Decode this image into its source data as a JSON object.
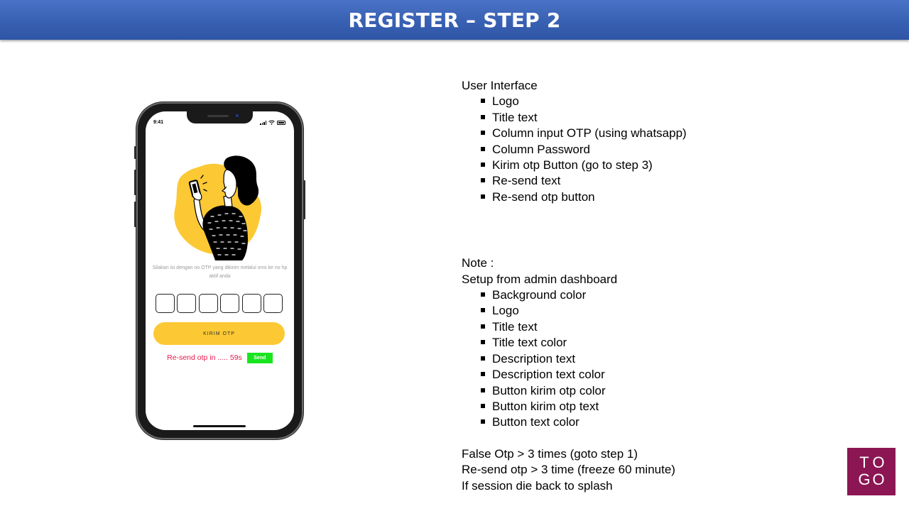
{
  "header": {
    "title": "REGISTER – STEP 2"
  },
  "phone": {
    "status_time": "9:41",
    "description": "Silakan isi dengan no OTP yang dikirim melalui sms ke no hp aktif anda",
    "otp_box_count": 6,
    "kirim_button_label": "KIRIM OTP",
    "resend_text": "Re-send otp in ..... 59s",
    "send_button_label": "Send",
    "colors": {
      "kirim_button": "#fcc934",
      "resend_text": "#e8194a",
      "send_button": "#19e51f",
      "illustration_blob": "#fcc934"
    }
  },
  "panel": {
    "ui_heading": "User Interface",
    "ui_items": [
      "Logo",
      "Title text",
      "Column input OTP (using whatsapp)",
      "Column Password",
      "Kirim otp Button (go to step 3)",
      "Re-send text",
      "Re-send otp button"
    ],
    "note_heading": "Note :",
    "note_subheading": "Setup from admin dashboard",
    "note_items": [
      "Background color",
      "Logo",
      "Title text",
      "Title text color",
      "Description text",
      "Description text color",
      "Button kirim otp color",
      "Button kirim otp text",
      "Button text color"
    ],
    "footer_lines": [
      "False Otp > 3 times (goto step 1)",
      "Re-send otp > 3 time  (freeze 60 minute)",
      "If session die back to splash"
    ]
  },
  "logo": {
    "letters": [
      "T",
      "O",
      "G",
      "O"
    ],
    "color": "#8b1653"
  }
}
